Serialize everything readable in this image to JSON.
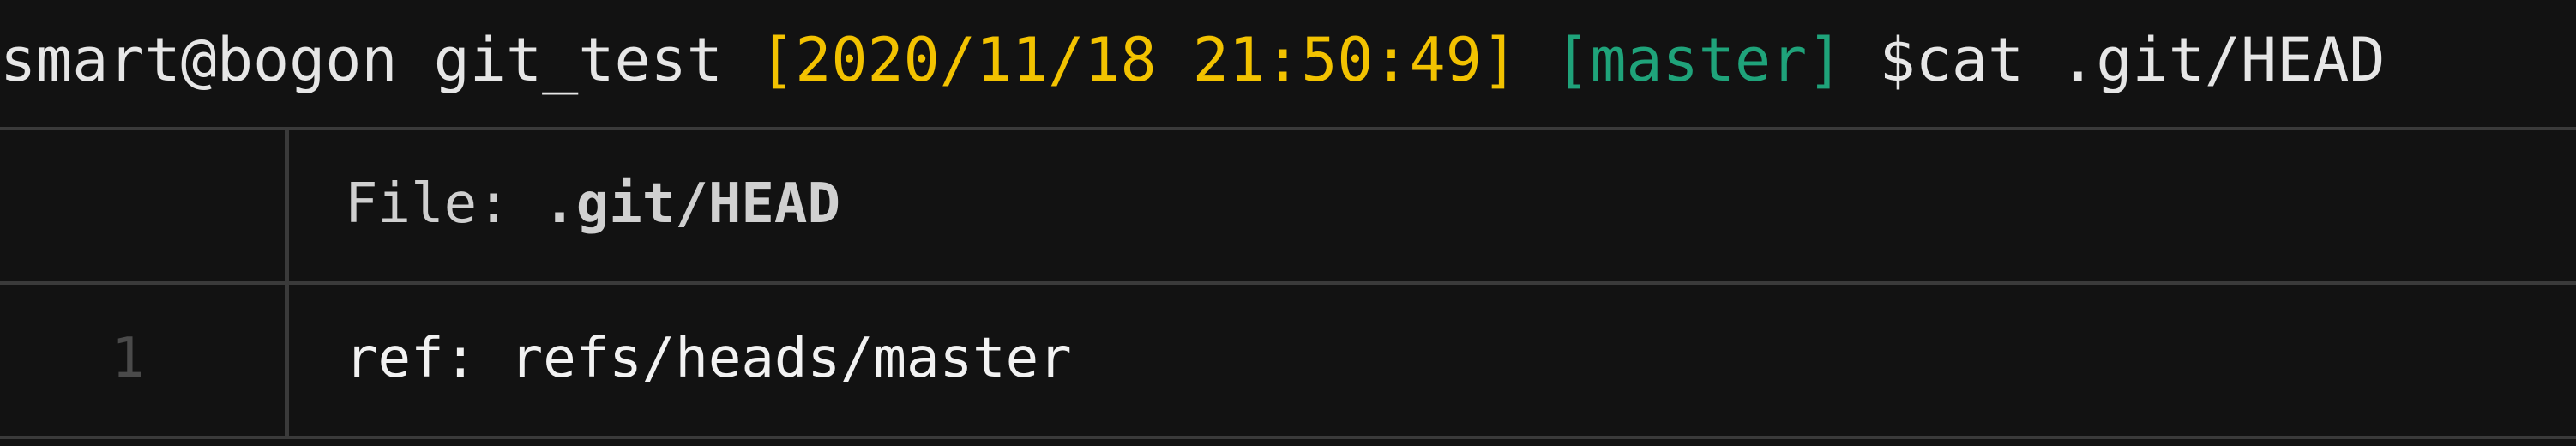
{
  "prompt": {
    "user_host": "smart@bogon",
    "cwd": "git_test",
    "timestamp": "[2020/11/18 21:50:49]",
    "branch": "[master]",
    "command": "$cat .git/HEAD"
  },
  "bat": {
    "file_label": "File:",
    "file_path": ".git/HEAD",
    "lines": [
      {
        "number": "1",
        "content": "ref: refs/heads/master"
      }
    ]
  },
  "colors": {
    "background": "#121212",
    "timestamp": "#f2c200",
    "branch": "#1fa37a",
    "rule": "#3a3a3a"
  }
}
